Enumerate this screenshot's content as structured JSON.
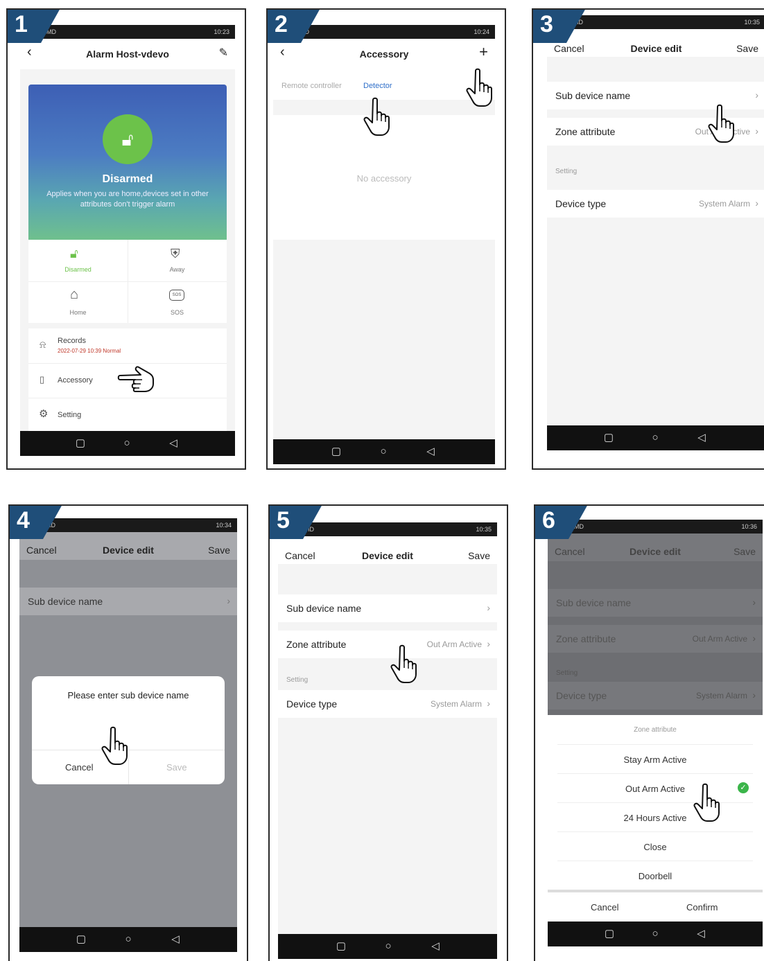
{
  "panels": [
    {
      "step": "1",
      "status_left": "MD",
      "status_right": "10:23",
      "header": {
        "title": "Alarm Host-vdevo"
      },
      "hero": {
        "state": "Disarmed",
        "description": "Applies when you are home,devices set in other attributes  don't trigger alarm"
      },
      "modes": [
        {
          "label": "Disarmed"
        },
        {
          "label": "Away"
        },
        {
          "label": "Home"
        },
        {
          "label": "SOS"
        }
      ],
      "menu": [
        {
          "label": "Records",
          "sub": "2022-07-29 10:39 Normal"
        },
        {
          "label": "Accessory"
        },
        {
          "label": "Setting"
        }
      ]
    },
    {
      "step": "2",
      "status_left": "MD",
      "status_right": "10:24",
      "header": {
        "title": "Accessory"
      },
      "tabs": [
        {
          "label": "Remote controller"
        },
        {
          "label": "Detector"
        }
      ],
      "empty": "No accessory"
    },
    {
      "step": "3",
      "status_left": "MD",
      "status_right": "10:35",
      "header": {
        "left": "Cancel",
        "title": "Device edit",
        "right": "Save"
      },
      "rows": [
        {
          "label": "Sub device name",
          "value": ""
        },
        {
          "label": "Zone attribute",
          "value": "Out Arm Active"
        }
      ],
      "section": "Setting",
      "rows2": [
        {
          "label": "Device type",
          "value": "System Alarm"
        }
      ]
    },
    {
      "step": "4",
      "status_left": "MD",
      "status_right": "10:34",
      "header": {
        "left": "Cancel",
        "title": "Device edit",
        "right": "Save"
      },
      "rows": [
        {
          "label": "Sub device name"
        }
      ],
      "dialog": {
        "title": "Please enter sub device name",
        "cancel": "Cancel",
        "save": "Save"
      }
    },
    {
      "step": "5",
      "status_left": "MD",
      "status_right": "10:35",
      "header": {
        "left": "Cancel",
        "title": "Device edit",
        "right": "Save"
      },
      "rows": [
        {
          "label": "Sub device name",
          "value": ""
        },
        {
          "label": "Zone attribute",
          "value": "Out Arm Active"
        }
      ],
      "section": "Setting",
      "rows2": [
        {
          "label": "Device type",
          "value": "System Alarm"
        }
      ]
    },
    {
      "step": "6",
      "status_left": "MD",
      "status_right": "10:36",
      "header": {
        "left": "Cancel",
        "title": "Device edit",
        "right": "Save"
      },
      "rows": [
        {
          "label": "Sub device name",
          "value": ""
        },
        {
          "label": "Zone attribute",
          "value": "Out Arm Active"
        }
      ],
      "section": "Setting",
      "rows2": [
        {
          "label": "Device type",
          "value": "System Alarm"
        }
      ],
      "sheet": {
        "title": "Zone attribute",
        "options": [
          {
            "label": "Stay Arm Active",
            "selected": false
          },
          {
            "label": "Out Arm Active",
            "selected": true
          },
          {
            "label": "24 Hours Active",
            "selected": false
          },
          {
            "label": "Close",
            "selected": false
          },
          {
            "label": "Doorbell",
            "selected": false
          }
        ],
        "cancel": "Cancel",
        "confirm": "Confirm"
      }
    }
  ],
  "colors": {
    "badge": "#1f4e79",
    "accent_green": "#6cc24a",
    "link_blue": "#2f6fc9",
    "check_green": "#3bb54a"
  },
  "icons": [
    "lock-open-icon",
    "shield-icon",
    "home-icon",
    "sos-icon",
    "bell-icon",
    "accessory-icon",
    "gear-icon",
    "pointing-hand-icon",
    "chevron-right-icon",
    "back-arrow-icon",
    "edit-icon",
    "plus-icon",
    "check-circle-icon"
  ]
}
